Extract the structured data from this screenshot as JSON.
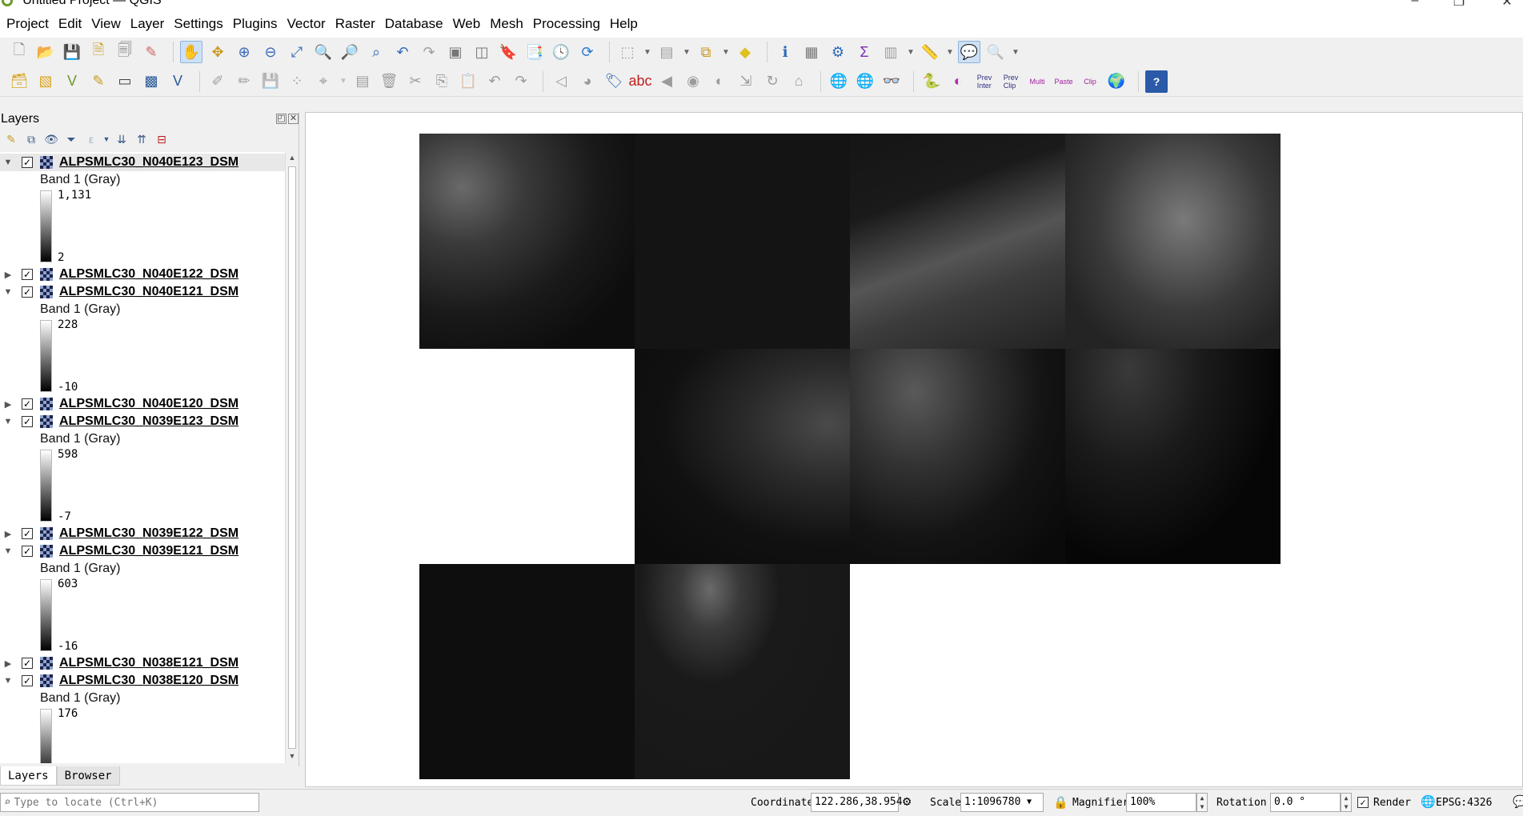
{
  "window": {
    "title": "*Untitled Project — QGIS"
  },
  "menu": [
    "Project",
    "Edit",
    "View",
    "Layer",
    "Settings",
    "Plugins",
    "Vector",
    "Raster",
    "Database",
    "Web",
    "Mesh",
    "Processing",
    "Help"
  ],
  "layers_panel": {
    "title": "Layers",
    "tree": [
      {
        "name": "ALPSMLC30_N040E123_DSM",
        "expanded": true,
        "checked": true,
        "band": "Band 1 (Gray)",
        "max": "1,131",
        "min": "2"
      },
      {
        "name": "ALPSMLC30_N040E122_DSM",
        "expanded": false,
        "checked": true
      },
      {
        "name": "ALPSMLC30_N040E121_DSM",
        "expanded": true,
        "checked": true,
        "band": "Band 1 (Gray)",
        "max": "228",
        "min": "-10"
      },
      {
        "name": "ALPSMLC30_N040E120_DSM",
        "expanded": false,
        "checked": true
      },
      {
        "name": "ALPSMLC30_N039E123_DSM",
        "expanded": true,
        "checked": true,
        "band": "Band 1 (Gray)",
        "max": "598",
        "min": "-7"
      },
      {
        "name": "ALPSMLC30_N039E122_DSM",
        "expanded": false,
        "checked": true
      },
      {
        "name": "ALPSMLC30_N039E121_DSM",
        "expanded": true,
        "checked": true,
        "band": "Band 1 (Gray)",
        "max": "603",
        "min": "-16"
      },
      {
        "name": "ALPSMLC30_N038E121_DSM",
        "expanded": false,
        "checked": true
      },
      {
        "name": "ALPSMLC30_N038E120_DSM",
        "expanded": true,
        "checked": true,
        "band": "Band 1 (Gray)",
        "max": "176",
        "min": ""
      }
    ],
    "tabs": [
      "Layers",
      "Browser"
    ]
  },
  "statusbar": {
    "locate_placeholder": "Type to locate (Ctrl+K)",
    "coordinate_label": "Coordinate",
    "coordinate_value": "122.286,38.954",
    "scale_label": "Scale",
    "scale_value": "1:1096780",
    "magnifier_label": "Magnifier",
    "magnifier_value": "100%",
    "rotation_label": "Rotation",
    "rotation_value": "0.0 °",
    "render_label": "Render",
    "crs": "EPSG:4326"
  }
}
